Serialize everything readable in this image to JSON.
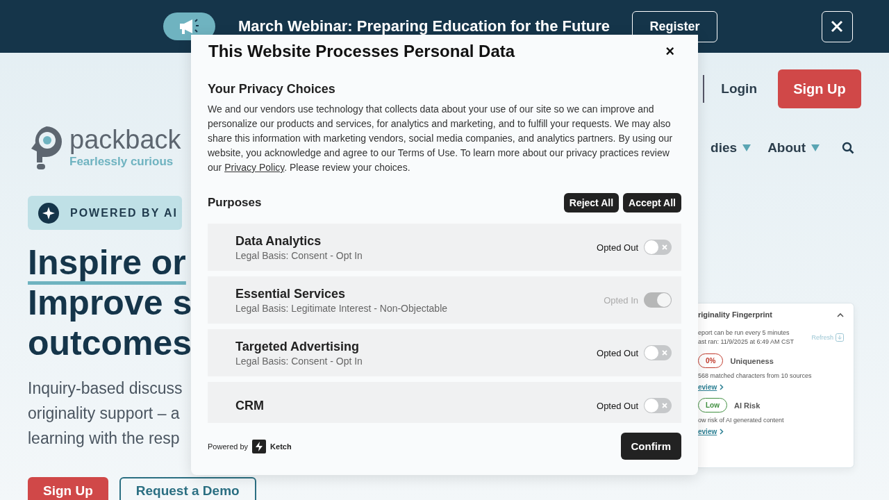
{
  "banner": {
    "message": "March Webinar: Preparing Education for the Future",
    "button": "Register"
  },
  "header": {
    "login": "Login",
    "signup": "Sign Up"
  },
  "logo": {
    "wordmark": "packback",
    "tagline": "Fearlessly curious"
  },
  "nav": [
    "dies",
    "About"
  ],
  "hero": {
    "badge": "POWERED BY AI",
    "headline": [
      "Inspire or",
      "Improve s",
      "outcomes"
    ],
    "description": [
      "Inquiry-based discuss",
      "originality support – a",
      "learning with the resp"
    ],
    "buttons": [
      {
        "label": "Sign Up",
        "kind": "primary"
      },
      {
        "label": "Request a Demo",
        "kind": "outline"
      }
    ]
  },
  "report_card": {
    "title": "riginality Fingerprint",
    "note": [
      "eport can be run every 5 minutes",
      "ast ran: 11/9/2025 at 6:49 AM CST"
    ],
    "refresh": "Refresh",
    "metrics": [
      {
        "badge": "0%",
        "color": "#c0392b",
        "label": "Uniqueness",
        "detail": "568 matched characters from 10 sources",
        "link": "eview"
      },
      {
        "badge": "Low",
        "color": "#3f8f3f",
        "label": "AI Risk",
        "detail": "ow risk of AI generated content",
        "link": "eview"
      }
    ]
  },
  "consent": {
    "title": "This Website Processes Personal Data",
    "close": "×",
    "section_title": "Your Privacy Choices",
    "intro": "We and our vendors use technology that collects data about your use of our site so we can improve and personalize our products and services, for analytics and marketing, and to fulfill your requests. We may also share this information with marketing vendors, social media companies, and analytics partners. By using our website, you acknowledge and agree to our Terms of Use. To learn more about our privacy practices review our ",
    "intro_link": "Privacy Policy",
    "intro_end": ". Please review your choices.",
    "purposes_title": "Purposes",
    "reject": "Reject All",
    "accept": "Accept All",
    "purposes": [
      {
        "name": "Data Analytics",
        "basis": "Legal Basis: Consent - Opt In",
        "status": "Opted Out",
        "on": false,
        "disabled": false
      },
      {
        "name": "Essential Services",
        "basis": "Legal Basis: Legitimate Interest - Non-Objectable",
        "status": "Opted In",
        "on": true,
        "disabled": true
      },
      {
        "name": "Targeted Advertising",
        "basis": "Legal Basis: Consent - Opt In",
        "status": "Opted Out",
        "on": false,
        "disabled": false
      },
      {
        "name": "CRM",
        "status": "Opted Out",
        "on": false,
        "disabled": false
      }
    ],
    "powered_by": "Powered by",
    "brand": "Ketch",
    "confirm": "Confirm"
  }
}
